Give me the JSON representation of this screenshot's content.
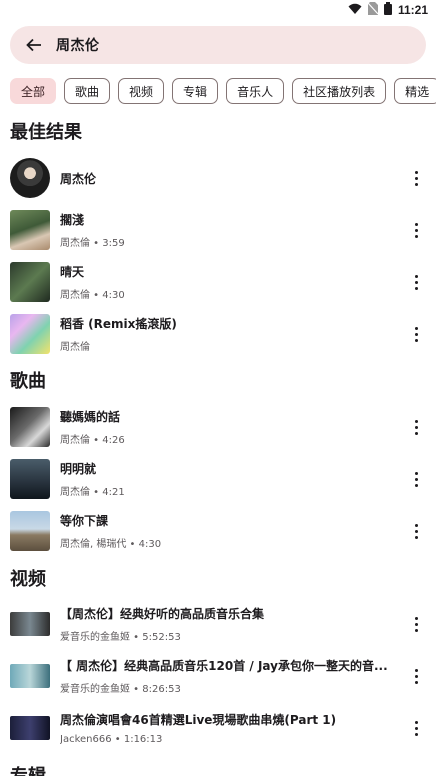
{
  "status": {
    "time": "11:21"
  },
  "search": {
    "query": "周杰伦"
  },
  "chips": [
    "全部",
    "歌曲",
    "视频",
    "专辑",
    "音乐人",
    "社区播放列表",
    "精选"
  ],
  "sections": {
    "best": "最佳结果",
    "songs": "歌曲",
    "videos": "视频",
    "albums": "专辑"
  },
  "best": [
    {
      "title": "周杰伦",
      "subtitle": ""
    },
    {
      "title": "擱淺",
      "subtitle": "周杰倫 • 3:59"
    },
    {
      "title": "晴天",
      "subtitle": "周杰倫 • 4:30"
    },
    {
      "title": "稻香 (Remix搖滾版)",
      "subtitle": "周杰倫"
    }
  ],
  "songs": [
    {
      "title": "聽媽媽的話",
      "subtitle": "周杰倫 • 4:26"
    },
    {
      "title": "明明就",
      "subtitle": "周杰倫 • 4:21"
    },
    {
      "title": "等你下課",
      "subtitle": "周杰倫, 楊瑞代 • 4:30"
    }
  ],
  "videos": [
    {
      "title": "【周杰伦】经典好听的高品质音乐合集",
      "subtitle": "爱音乐的金鱼姬 • 5:52:53"
    },
    {
      "title": "【 周杰伦】经典高品质音乐120首 / Jay承包你一整天的音...",
      "subtitle": "爱音乐的金鱼姬 • 8:26:53"
    },
    {
      "title": "周杰倫演唱會46首精選Live現場歌曲串燒(Part 1)",
      "subtitle": "Jacken666 • 1:16:13"
    }
  ],
  "colors": {
    "chip_active": "#f8d9da",
    "search_bg": "#f6e5e5"
  }
}
